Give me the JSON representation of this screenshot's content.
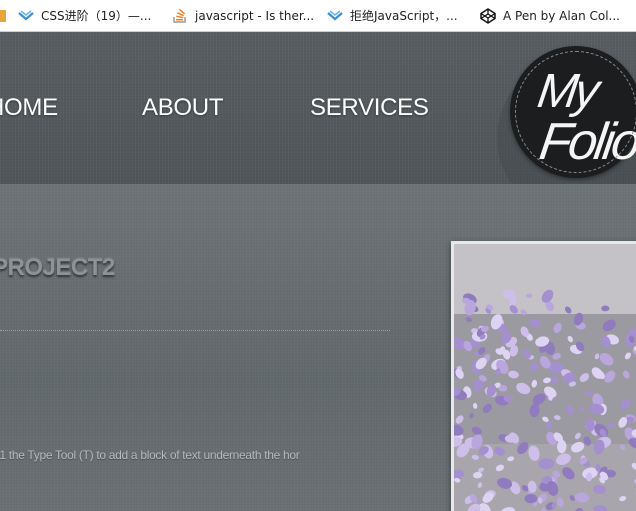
{
  "bookmarks": [
    {
      "label": "",
      "icon": "cut-off-icon"
    },
    {
      "label": "CSS进阶（19）—...",
      "icon": "chevron-logo-icon"
    },
    {
      "label": "javascript - Is ther...",
      "icon": "stackoverflow-icon"
    },
    {
      "label": "拒绝JavaScript，...",
      "icon": "chevron-logo-icon"
    },
    {
      "label": "A Pen by Alan Col...",
      "icon": "codepen-icon"
    }
  ],
  "nav": {
    "home": "HOME",
    "about": "ABOUT",
    "services": "SERVICES"
  },
  "logo": {
    "line1": "My",
    "line2": "Folio"
  },
  "main": {
    "project_title": "PROJECT2",
    "body_text": "e1 the Type Tool (T) to add a block of text underneath the hor",
    "image_alt": "purple heart confetti"
  },
  "colors": {
    "header_bg": "#555b5f",
    "content_bg": "#697074",
    "nav_text": "#ffffff",
    "logo_bg": "#1c1d1f",
    "confetti": "#b9a6dc"
  }
}
